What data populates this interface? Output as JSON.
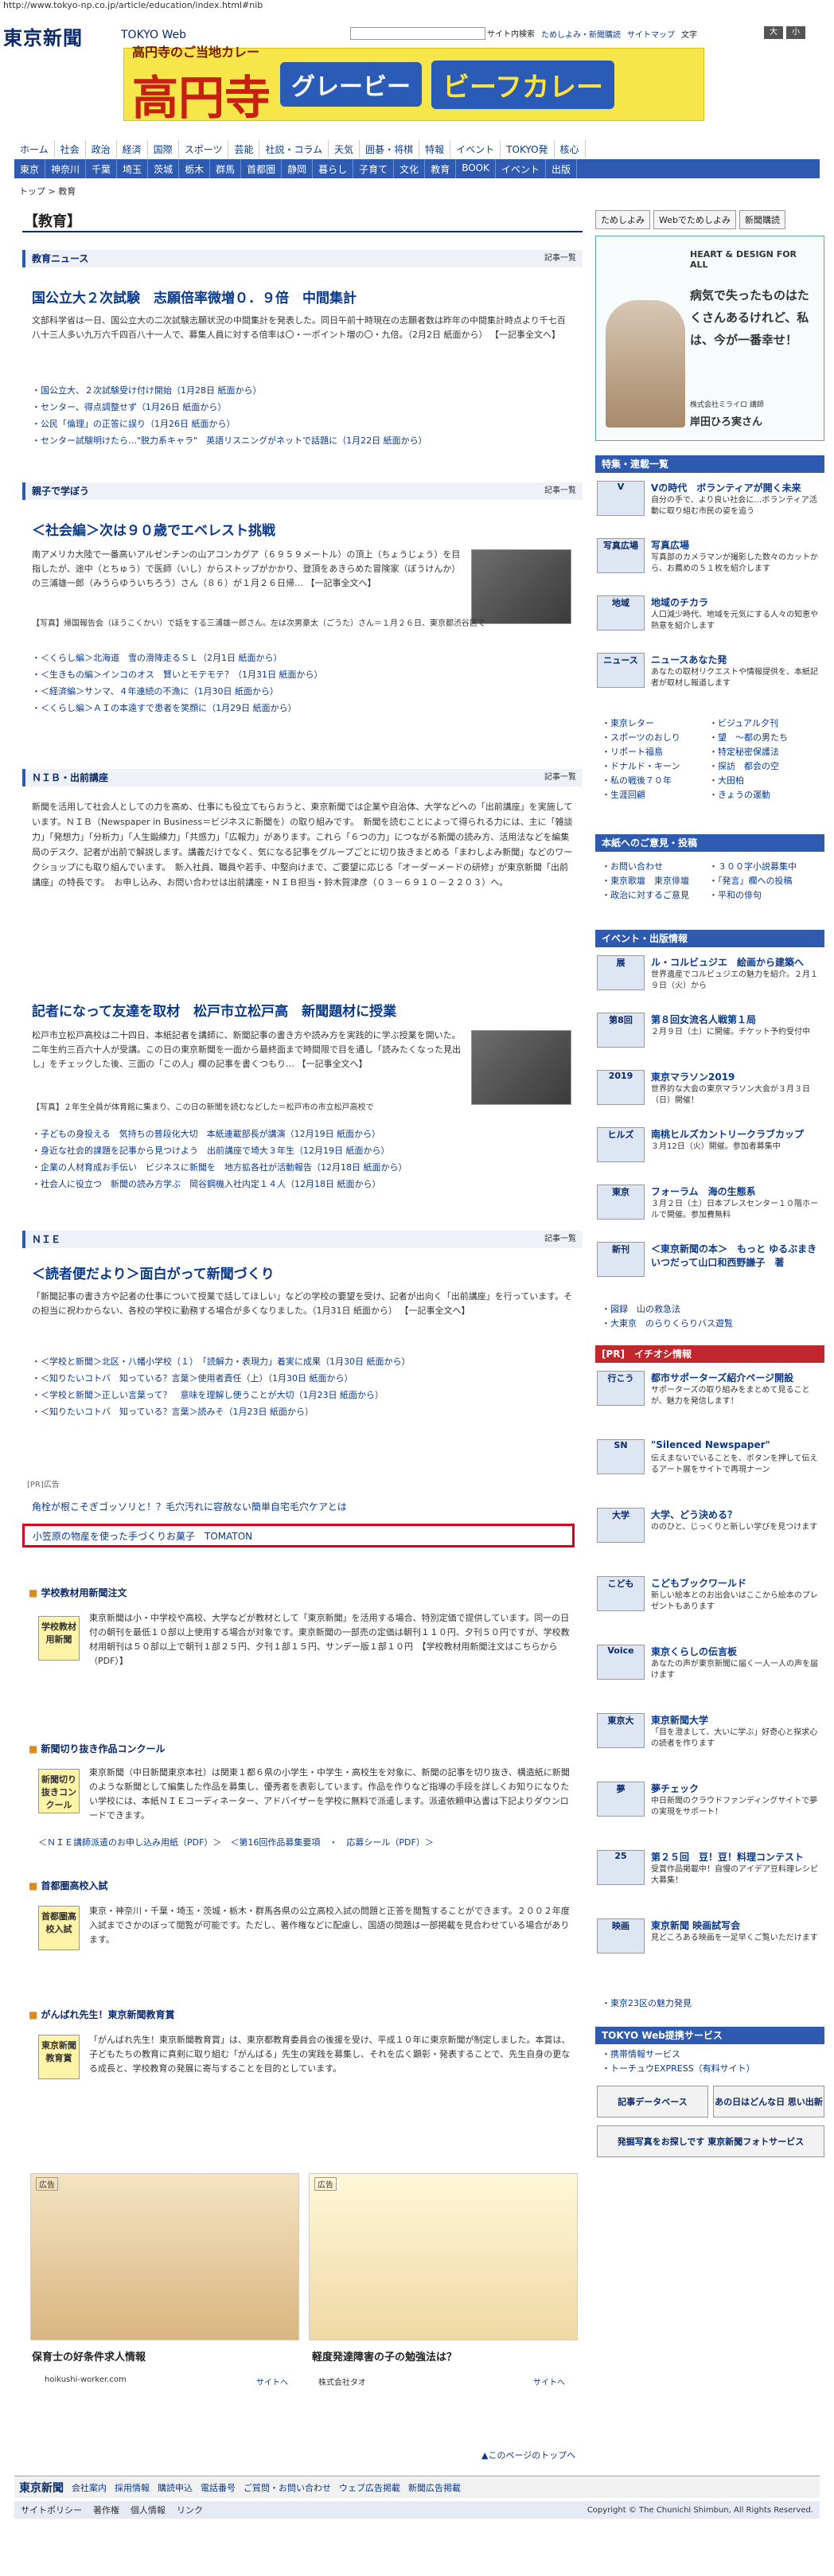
{
  "url": "http://www.tokyo-np.co.jp/article/education/index.html#nib",
  "header": {
    "logo": "東京新聞",
    "logo_sub": "TOKYO Web",
    "search_button": "サイト内検索",
    "links": [
      "ためしよみ・新聞購読",
      "サイトマップ"
    ],
    "font_label": "文字",
    "font_small": "小",
    "font_large": "大"
  },
  "banner": {
    "small": "高円寺のご当地カレー",
    "big": "高円寺",
    "badge1": "グレービー",
    "badge2": "ビーフカレー"
  },
  "nav_main": [
    "ホーム",
    "社会",
    "政治",
    "経済",
    "国際",
    "スポーツ",
    "芸能",
    "社説・コラム",
    "天気",
    "囲碁・将棋",
    "特報",
    "イベント",
    "TOKYO発",
    "核心"
  ],
  "nav_sub": [
    "東京",
    "神奈川",
    "千葉",
    "埼玉",
    "茨城",
    "栃木",
    "群馬",
    "首都圏",
    "静岡",
    "暮らし",
    "子育て",
    "文化",
    "教育",
    "BOOK",
    "イベント",
    "出版"
  ],
  "breadcrumb": "トップ > 教育",
  "section_title": "【教育】",
  "more_label": "記事一覧",
  "sections": {
    "news": {
      "header": "教育ニュース",
      "headline": "国公立大２次試験　志願倍率微増０．９倍　中間集計",
      "body": "文部科学省は一日、国公立大の二次試験志願状況の中間集計を発表した。同日午前十時現在の志願者数は昨年の中間集計時点より千七百八十三人多い九万六千四百八十一人で、募集人員に対する倍率は〇・一ポイント増の〇・九倍。（2月2日 紙面から） 【一記事全文へ】",
      "items": [
        "国公立大、２次試験受け付け開始（1月28日 紙面から）",
        "センター、得点調整せず（1月26日 紙面から）",
        "公民「倫理」の正答に誤り（1月26日 紙面から）",
        "センター試験明けたら…\"脱力系キャラ\"　英語リスニングがネットで話題に（1月22日 紙面から）"
      ]
    },
    "parent": {
      "header": "親子で学ぼう",
      "headline": "＜社会編＞次は９０歳でエベレスト挑戦",
      "body": "南アメリカ大陸で一番高いアルゼンチンの山アコンカグア（６９５９メートル）の頂上（ちょうじょう）を目指したが、途中（とちゅう）で医師（いし）からストップがかかり、登頂をあきらめた冒険家（ぼうけんか）の三浦雄一郎（みうらゆういちろう）さん（８６）が１月２６日帰… 【一記事全文へ】",
      "caption": "【写真】帰国報告会（ほうこくかい）で話をする三浦雄一郎さん。左は次男豪太（ごうた）さん＝１月２６日、東京都渋谷区で",
      "items": [
        "＜くらし編＞北海道　雪の滑降走るＳＬ（2月1日 紙面から）",
        "＜生きもの編＞インコのオス　賢いとモテモテ？（1月31日 紙面から）",
        "＜経済編＞サンマ、４年連続の不漁に（1月30日 紙面から）",
        "＜くらし編＞ＡＩの本遠すで患者を笑顔に（1月29日 紙面から）"
      ]
    },
    "nib": {
      "header": "ＮＩＢ・出前講座",
      "body": "新聞を活用して社会人としての力を高め、仕事にも役立てもらおうと、東京新聞では企業や自治体、大学などへの「出前講座」を実施しています。ＮＩＢ（Newspaper in Business＝ビジネスに新聞を）の取り組みです。　新聞を読むことによって得られる力には、主に「雑談力」「発想力」「分析力」「人生鍛練力」「共感力」「広報力」があります。これら「６つの力」につながる新聞の読み方、活用法などを編集局のデスク、記者が出前で解説します。講義だけでなく、気になる記事をグループごとに切り抜きまとめる「まわしよみ新聞」などのワークショップにも取り組んでいます。　新入社員、職員や若手、中堅向けまで、ご要望に応じる「オーダーメードの研修」が東京新聞「出前講座」の特長です。　お申し込み、お問い合わせは出前講座・ＮＩＢ担当・鈴木賀津彦（０３－６９１０－２２０３）へ。",
      "headline2": "記者になって友達を取材　松戸市立松戸高　新聞題材に授業",
      "body2": "松戸市立松戸高校は二十四日、本紙記者を講師に、新聞記事の書き方や読み方を実践的に学ぶ授業を開いた。　二年生約三百六十人が受講。この日の東京新聞を一面から最終面まで時間限で目を通し「読みたくなった見出し」をチェックした後、三面の「この人」欄の記事を書くつもり… 【一記事全文へ】",
      "caption2": "【写真】２年生全員が体育館に集まり、この日の新聞を読むなどした＝松戸市の市立松戸高校で",
      "items": [
        "子どもの身投える　気持ちの普段化大切　本紙連載部長が講演（12月19日 紙面から）",
        "身近な社会的課題を記事から見つけよう　出前講座で埼大３年生（12月19日 紙面から）",
        "企業の人材育成お手伝い　ビジネスに新聞を　地方拡各社が活動報告（12月18日 紙面から）",
        "社会人に役立つ　新聞の読み方学ぶ　岡谷鋼機入社内定１４人（12月18日 紙面から）"
      ]
    },
    "nie": {
      "header": "ＮＩＥ",
      "headline": "＜読者便だより＞面白がって新聞づくり",
      "body": "「新聞記事の書き方や記者の仕事について授業で話してほしい」などの学校の要望を受け、記者が出向く「出前講座」を行っています。その担当に祝わからない、各校の学校に勤務する場合が多くなりました。（1月31日 紙面から） 【一記事全文へ】",
      "items": [
        "＜学校と新聞＞北区・八幡小学校（１）　「読解力・表現力」着実に成果（1月30日 紙面から）",
        "＜知りたいコトバ　知っている？言葉＞使用者責任（上）（1月30日 紙面から）",
        "＜学校と新聞＞正しい言葉って？　意味を理解し使うことが大切（1月23日 紙面から）",
        "＜知りたいコトバ　知っている？言葉＞読みそ（1月23日 紙面から）"
      ]
    }
  },
  "promo_label": "[PR]広告",
  "promo1": "角栓が根こそぎゴッソリと！？毛穴汚れに容赦ない簡単自宅毛穴ケアとは",
  "promo2": "小笠原の物産を使った手づくりお菓子　TOMATON",
  "school": {
    "title": "学校教材用新聞注文",
    "icon": "学校教材用新聞",
    "body": "東京新聞は小・中学校や高校、大学などが教材として「東京新聞」を活用する場合、特別定価で提供しています。同一の日付の朝刊を最低１０部以上使用する場合が対象です。東京新聞の一部売の定価は朝刊１１０円、夕刊５０円ですが、学校教材用朝刊は５０部以上で朝刊１部２５円、夕刊１部１５円、サンデー版１部１０円　【学校教材用新聞注文はこちらから（PDF）】"
  },
  "contest": {
    "title": "新聞切り抜き作品コンクール",
    "icon": "新聞切り抜きコンクール",
    "body": "東京新聞（中日新聞東京本社）は関東１都６県の小学生・中学生・高校生を対象に、新聞の記事を切り抜き、構造紙に新聞のような新聞として編集した作品を募集し、優秀者を表彰しています。作品を作りなど指導の手段を詳しくお知りになりたい学校には、本紙ＮＩＥコーディネーター、アドバイザーを学校に無料で派遣します。派遣依頼申込書は下記よりダウンロードできます。",
    "links": "＜ＮＩＥ講師派遣のお申し込み用紙（PDF）＞　＜第16回作品募集要項　・　応募シール（PDF）＞"
  },
  "exam": {
    "title": "首都圏高校入試",
    "icon": "首都圏高校入試",
    "body": "東京・神奈川・千葉・埼玉・茨城・栃木・群馬各県の公立高校入試の問題と正答を閲覧することができます。２００２年度入試までさかのぼって閲覧が可能です。ただし、著作権などに配慮し、国語の問題は一部掲載を見合わせている場合があります。"
  },
  "ganbare": {
    "title": "がんばれ先生！東京新聞教育賞",
    "icon": "東京新聞教育賞",
    "body": "「がんばれ先生！東京新聞教育賞」は、東京都教育委員会の後援を受け、平成１０年に東京新聞が制定しました。本賞は、子どもたちの教育に真剣に取り組む「がんばる」先生の実践を募集し、それを広く顕彰・発表することで、先生自身の更なる成長と、学校教育の発展に寄与することを目的としています。"
  },
  "ads": [
    {
      "label": "広告",
      "title": "保育士の好条件求人情報",
      "site": "hoikushi-worker.com",
      "link": "サイトへ"
    },
    {
      "label": "広告",
      "title": "軽度発達障害の子の勉強法は？",
      "site": "株式会社タオ",
      "link": "サイトへ"
    }
  ],
  "right": {
    "tabs": [
      "ためしよみ",
      "Webでためしよみ",
      "新聞購読"
    ],
    "heart_title": "HEART & DESIGN FOR ALL",
    "heart_quote": "病気で失ったものはたくさんあるけれど、私は、今が一番幸せ！",
    "heart_name": "岸田ひろ実さん",
    "heart_org": "株式会社ミライロ 講師",
    "feature_header": "特集・連載一覧",
    "features": [
      {
        "icon": "V",
        "title": "Vの時代　ボランティアが開く未来",
        "desc": "自分の手で、より良い社会に…ボランティア活動に取り組む市民の姿を追う"
      },
      {
        "icon": "写真広場",
        "title": "写真広場",
        "desc": "写真部のカメラマンが撮影した数々のカットから、お薦めの５１枚を紹介します"
      },
      {
        "icon": "地域",
        "title": "地域のチカラ",
        "desc": "人口減少時代、地域を元気にする人々の知恵や熱意を紹介します"
      },
      {
        "icon": "ニュース",
        "title": "ニュースあなた発",
        "desc": "あなたの取材リクエストや情報提供を、本紙記者が取材し報道します"
      }
    ],
    "grid_links": [
      "東京レター",
      "ビジュアル夕刊",
      "スポーツのおしり",
      "望　～都の男たち",
      "リポート福島",
      "特定秘密保護法",
      "ドナルド・キーン",
      "探訪　都会の空",
      "私の戦後７０年",
      "大田柏",
      "生涯回顧",
      "きょうの運動"
    ],
    "guide_header": "本紙へのご意見・投稿",
    "guide_links": [
      "お問い合わせ",
      "３００字小説募集中",
      "東京歌壇　東京俳壇",
      "「発言」欄への投稿",
      "政治に対するご意見",
      "平和の俳句"
    ],
    "event_header": "イベント・出版情報",
    "events": [
      {
        "icon": "展",
        "title": "ル・コルビュジエ　絵画から建築へ",
        "desc": "世界遺産でコルビュジエの魅力を紹介。２月１９日（火）から"
      },
      {
        "icon": "第8回",
        "title": "第８回女流名人戦第１局",
        "desc": "２月９日（土）に開催。チケット予約受付中"
      },
      {
        "icon": "2019",
        "title": "東京マラソン2019",
        "desc": "世界的な大会の東京マラソン大会が３月３日（日）開催！"
      },
      {
        "icon": "ヒルズ",
        "title": "南桃ヒルズカントリークラブカップ",
        "desc": "３月12日（火）開催。参加者募集中"
      },
      {
        "icon": "東京",
        "title": "フォーラム　海の生態系",
        "desc": "３月２日（土）日本プレスセンター１０階ホールで開催。参加費無料"
      },
      {
        "icon": "新刊",
        "title": "＜東京新聞の本＞　もっと ゆるぶまき　いつだって山口和西野謙子　著",
        "desc": ""
      }
    ],
    "event_links": [
      "図録　山の救急法",
      "大東京　のらりくらりバス遊覧"
    ],
    "pr_header": "[PR]　イチオシ情報",
    "pr": [
      {
        "icon": "行こう",
        "title": "都市サポーターズ紹介ページ開設",
        "desc": "サポーターズの取り組みをまとめて見ることが、魅力を発信します！"
      },
      {
        "icon": "SN",
        "title": "\"Silenced Newspaper\"",
        "desc": "伝えまないでいることを、ボタンを押して伝えるアート展をサイトで再現ナーン"
      },
      {
        "icon": "大学",
        "title": "大学、どう決める？",
        "desc": "ののひと、じっくりと新しい学びを見つけます"
      },
      {
        "icon": "こども",
        "title": "こどもブックワールド",
        "desc": "新しい絵本とのお出会いはここから絵本のプレゼントもあります"
      },
      {
        "icon": "Voice",
        "title": "東京くらしの伝言板",
        "desc": "あなたの声が東京新聞に届く一人一人の声を届けます"
      },
      {
        "icon": "東京大",
        "title": "東京新聞大学",
        "desc": "「目を澄まして、大いに学ぶ」好奇心と探求心の読者を作ります"
      },
      {
        "icon": "夢",
        "title": "夢チェック",
        "desc": "中日新聞のクラウドファンディングサイトで夢の実現をサポート！"
      },
      {
        "icon": "25",
        "title": "第２５回　豆！豆！料理コンテスト",
        "desc": "受賞作品掲載中！自慢のアイデア豆料理レシピ大募集！"
      },
      {
        "icon": "映画",
        "title": "東京新聞 映画試写会",
        "desc": "見どころある映画を一足早くご覧いただけます"
      }
    ],
    "pr_link": "東京23区の魅力発見",
    "web_header": "TOKYO Web提携サービス",
    "web_links": [
      "携帯情報サービス",
      "トーチュウEXPRESS（有料サイト）"
    ],
    "btns": [
      "記事データベース",
      "あの日はどんな日 思い出新聞",
      "発掘写真をお探しです 東京新聞フォトサービス"
    ]
  },
  "pagetop": "▲このページのトップへ",
  "footer": {
    "logo": "東京新聞",
    "links": [
      "会社案内",
      "採用情報",
      "購読申込",
      "電話番号",
      "ご質問・お問い合わせ",
      "ウェブ広告掲載",
      "新聞広告掲載"
    ],
    "links2": [
      "サイトポリシー",
      "著作権",
      "個人情報",
      "リンク"
    ],
    "copyright": "Copyright © The Chunichi Shimbun, All Rights Reserved."
  }
}
